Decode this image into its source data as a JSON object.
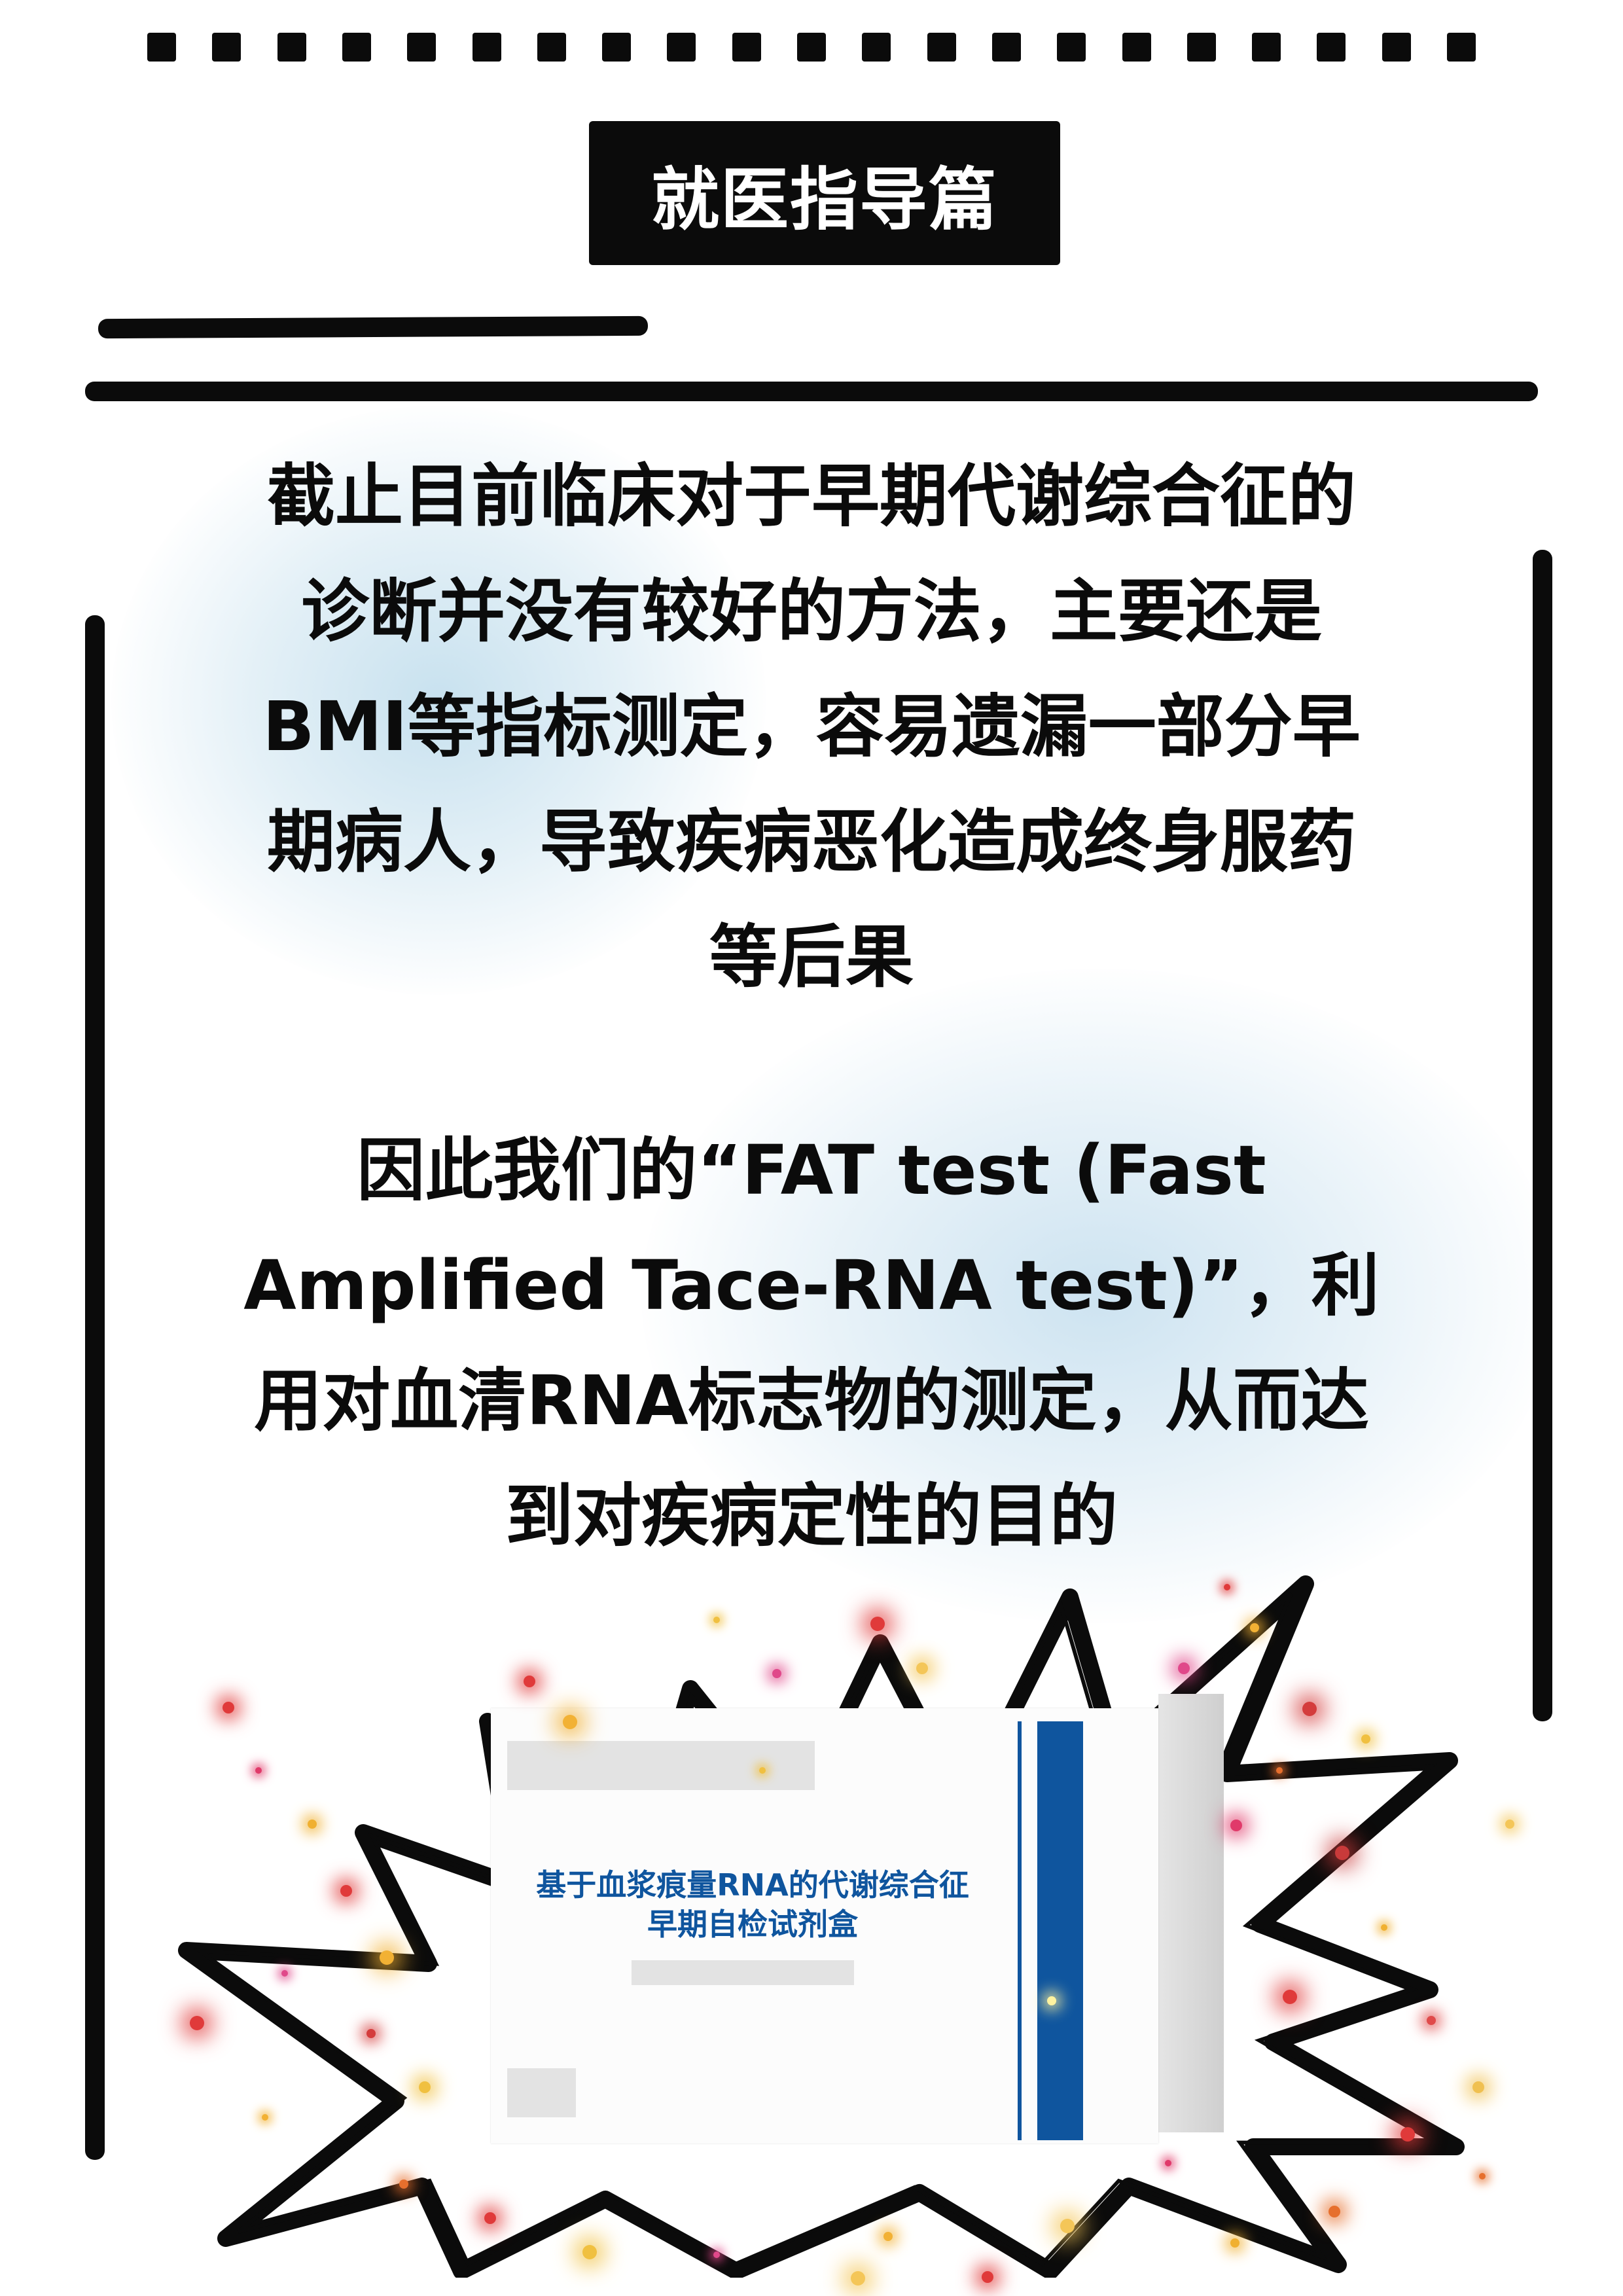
{
  "header": {
    "title": "就医指导篇"
  },
  "paragraphs": [
    {
      "lines": [
        "截止目前临床对于早期代谢综合征的",
        "诊断并没有较好的方法，主要还是",
        "BMI等指标测定，容易遗漏一部分早",
        "期病人，导致疾病恶化造成终身服药",
        "等后果"
      ]
    },
    {
      "lines": [
        "因此我们的“FAT test (Fast",
        "Amplified Tace-RNA test)”，利",
        "用对血清RNA标志物的测定，从而达",
        "到对疾病定性的目的"
      ]
    }
  ],
  "product": {
    "label_line1": "基于血浆痕量RNA的代谢综合征",
    "label_line2": "早期自检试剂盒",
    "accent_color": "#0f559e"
  },
  "colors": {
    "ink": "#0b0b0b",
    "glow": "#c8e1ee",
    "background": "#ffffff"
  }
}
